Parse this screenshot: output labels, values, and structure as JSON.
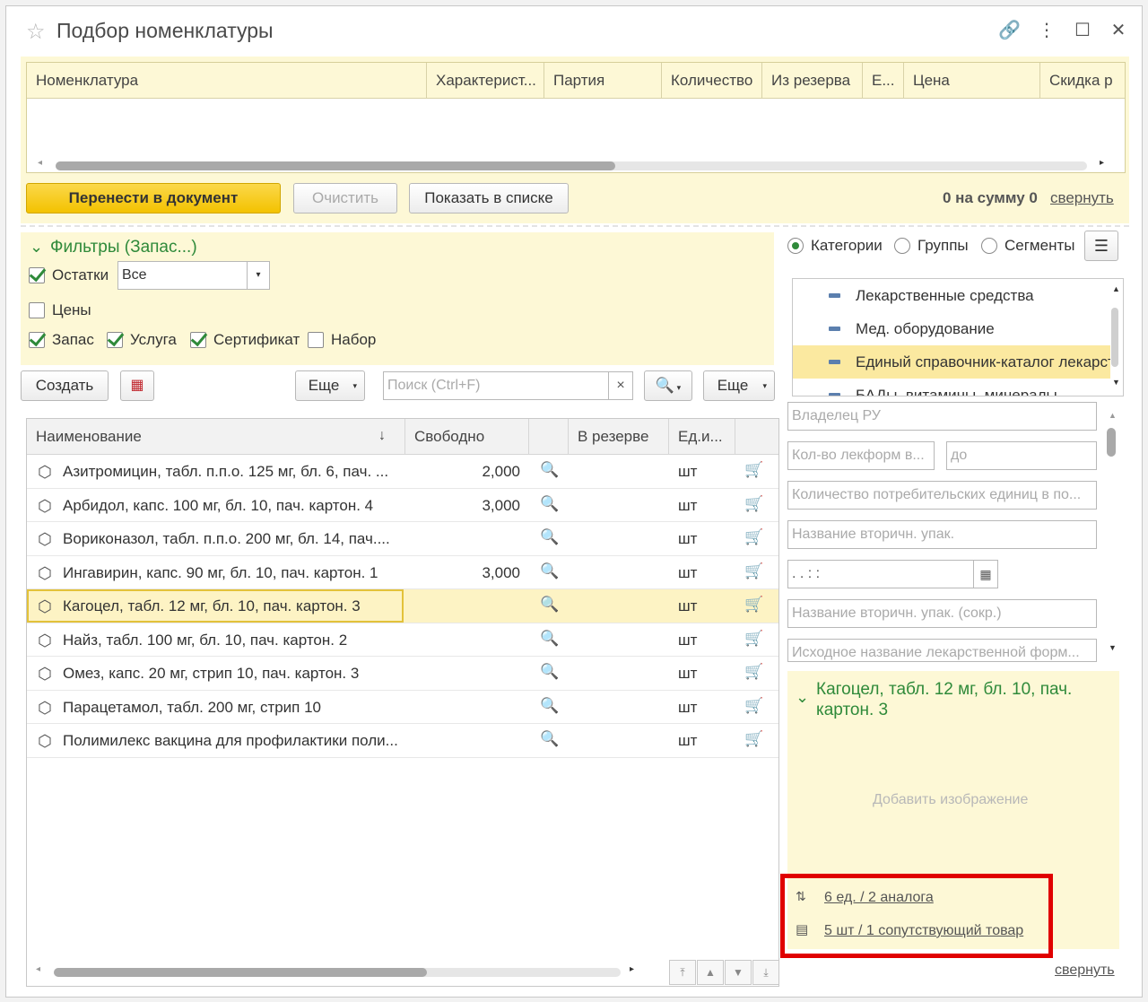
{
  "window": {
    "title": "Подбор номенклатуры"
  },
  "top_grid": {
    "columns": [
      "Номенклатура",
      "Характерист...",
      "Партия",
      "Количество",
      "Из резерва",
      "Е...",
      "Цена",
      "Скидка р"
    ]
  },
  "top_actions": {
    "transfer": "Перенести в документ",
    "clear": "Очистить",
    "show_in_list": "Показать в списке",
    "total": "0 на сумму 0",
    "collapse": "свернуть"
  },
  "filters": {
    "title": "Фильтры (Запас...)",
    "ostatki_label": "Остатки",
    "ostatki_value": "Все",
    "ceny_label": "Цены",
    "zapas_label": "Запас",
    "usluga_label": "Услуга",
    "sertifikat_label": "Сертификат",
    "nabor_label": "Набор"
  },
  "list_toolbar": {
    "create": "Создать",
    "more1": "Еще",
    "search_placeholder": "Поиск (Ctrl+F)",
    "clear_x": "×",
    "more2": "Еще"
  },
  "list": {
    "columns": [
      "Наименование",
      "↓",
      "Свободно",
      "В резерве",
      "Ед.и..."
    ],
    "rows": [
      {
        "name": "Азитромицин, табл. п.п.о. 125 мг, бл. 6, пач. ...",
        "free": "2,000",
        "unit": "шт"
      },
      {
        "name": "Арбидол, капс. 100 мг, бл. 10, пач. картон. 4",
        "free": "3,000",
        "unit": "шт"
      },
      {
        "name": "Вориконазол, табл. п.п.о. 200 мг, бл. 14, пач....",
        "free": "",
        "unit": "шт"
      },
      {
        "name": "Ингавирин, капс. 90 мг, бл. 10, пач. картон. 1",
        "free": "3,000",
        "unit": "шт"
      },
      {
        "name": "Кагоцел, табл. 12 мг, бл. 10, пач. картон. 3",
        "free": "",
        "unit": "шт"
      },
      {
        "name": "Найз, табл. 100 мг, бл. 10, пач. картон. 2",
        "free": "",
        "unit": "шт"
      },
      {
        "name": "Омез, капс. 20 мг, стрип 10, пач. картон. 3",
        "free": "",
        "unit": "шт"
      },
      {
        "name": "Парацетамол, табл. 200 мг, стрип 10",
        "free": "",
        "unit": "шт"
      },
      {
        "name": "Полимилекс вакцина для профилактики поли...",
        "free": "",
        "unit": "шт"
      }
    ]
  },
  "categories": {
    "radio_categories": "Категории",
    "radio_groups": "Группы",
    "radio_segments": "Сегменты",
    "items": [
      "Лекарственные средства",
      "Мед. оборудование",
      "Единый справочник-каталог лекарст",
      "БАДы, витамины, минералы"
    ]
  },
  "properties": {
    "fields": [
      "Владелец РУ",
      "Кол-во лекформ в...",
      "до",
      "Количество потребительских единиц в по...",
      "Название вторичн. упак.",
      " .  .      :  :",
      "Название вторичн. упак. (сокр.)",
      "Исходное название лекарственной форм..."
    ]
  },
  "details": {
    "title": "Кагоцел, табл. 12 мг, бл. 10, пач. картон. 3",
    "add_image": "Добавить изображение",
    "analogs_link": "6 ед. / 2 аналога",
    "related_link": "5 шт / 1 сопутствующий товар",
    "collapse": "свернуть"
  },
  "colors": {
    "accent_yellow": "#f3c200",
    "panel_yellow": "#fdf8d6",
    "green": "#2f8a3a",
    "highlight_red": "#e00000"
  }
}
